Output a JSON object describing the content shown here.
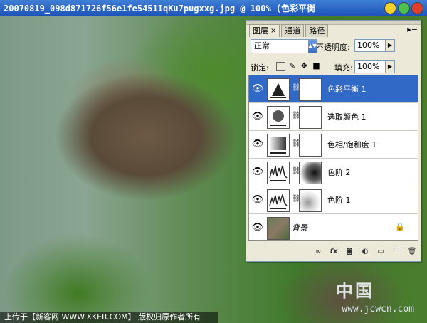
{
  "window": {
    "title": "20070819_098d871726f56e1fe5451IqKu7pugxxg.jpg @ 100% (色彩平衡"
  },
  "panel": {
    "tabs": [
      {
        "label": "图层",
        "active": true,
        "close": "×"
      },
      {
        "label": "通道",
        "active": false
      },
      {
        "label": "路径",
        "active": false
      }
    ],
    "blend_mode": "正常",
    "opacity_label": "不透明度:",
    "opacity_value": "100%",
    "lock_label": "锁定:",
    "fill_label": "填充:",
    "fill_value": "100%",
    "layers": [
      {
        "name": "色彩平衡 1",
        "selected": true,
        "thumb_icon": "color-balance-icon",
        "has_mask": true
      },
      {
        "name": "选取颜色 1",
        "selected": false,
        "thumb_icon": "selective-color-icon",
        "has_mask": true
      },
      {
        "name": "色相/饱和度 1",
        "selected": false,
        "thumb_icon": "hue-saturation-icon",
        "has_mask": true
      },
      {
        "name": "色阶 2",
        "selected": false,
        "thumb_icon": "levels-icon",
        "has_mask": true
      },
      {
        "name": "色阶 1",
        "selected": false,
        "thumb_icon": "levels-icon",
        "has_mask": true
      },
      {
        "name": "背景",
        "selected": false,
        "thumb_icon": "photo-thumbnail",
        "has_mask": false,
        "locked": true
      }
    ]
  },
  "status_bar": {
    "text": "上传于【新客网 WWW.XKER.COM】 版权归原作者所有"
  },
  "watermark": {
    "text_cn": "中国",
    "url": "www.jcwcn.com"
  },
  "colors": {
    "titlebar": "#1d54b8",
    "selection": "#3169c6",
    "panel_bg": "#ece9d8"
  }
}
